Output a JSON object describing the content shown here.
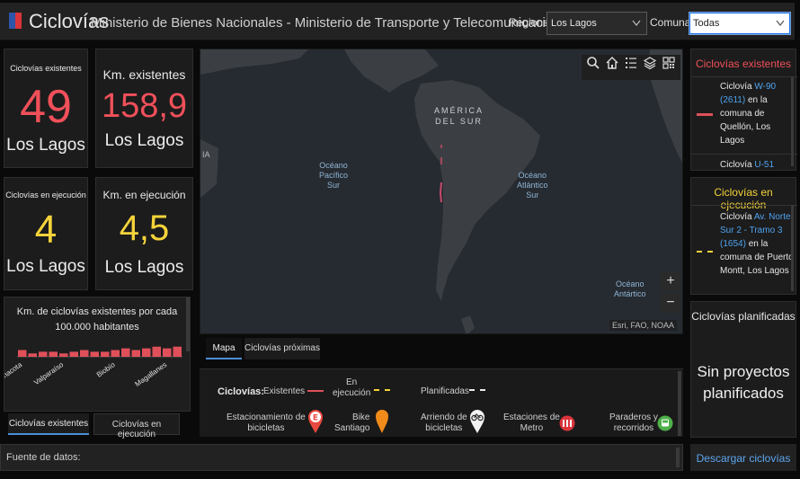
{
  "header": {
    "title": "Ciclovías",
    "subtitle": "Ministerio de Bienes Nacionales - Ministerio de Transporte y Telecomunicaciones",
    "regiones_label": "Regiones",
    "regiones_value": "Los Lagos",
    "comunas_label": "Comunas",
    "comunas_value": "Todas"
  },
  "stats": {
    "existing_count_label": "Ciclovías existentes",
    "existing_count": "49",
    "existing_count_region": "Los Lagos",
    "existing_km_label": "Km. existentes",
    "existing_km": "158,9",
    "existing_km_region": "Los Lagos",
    "exec_count_label": "Ciclovías en ejecución",
    "exec_count": "4",
    "exec_count_region": "Los Lagos",
    "exec_km_label": "Km. en ejecución",
    "exec_km": "4,5",
    "exec_km_region": "Los Lagos"
  },
  "chart_data": {
    "type": "bar",
    "title": "Km. de ciclovías existentes por cada 100.000 habitantes",
    "tick_labels": [
      "Parinacota",
      "Valparaíso",
      "Biobío",
      "Magallanes"
    ],
    "values": [
      4,
      2,
      3,
      3,
      2,
      3,
      4,
      3,
      3,
      4,
      5,
      4,
      5,
      6,
      5,
      6
    ],
    "color": "#e0505a",
    "xlabel": "",
    "ylabel": ""
  },
  "left_tabs": [
    "Ciclovías existentes",
    "Ciclovías en ejecución"
  ],
  "map": {
    "labels": {
      "continent_1": "AMÉRICA",
      "continent_2": "DEL SUR",
      "pacific_1": "Océano",
      "pacific_2": "Pacífico",
      "pacific_3": "Sur",
      "atlantic_1": "Océano",
      "atlantic_2": "Atlántico",
      "atlantic_3": "Sur",
      "antarctic_1": "Océano",
      "antarctic_2": "Antártico",
      "edge": "IA"
    },
    "attribution": "Esri, FAO, NOAA",
    "zoom_in": "+",
    "zoom_out": "−",
    "tools": [
      "search-icon",
      "home-icon",
      "list-icon",
      "layers-icon",
      "qr-icon"
    ]
  },
  "map_tabs": [
    "Mapa",
    "Ciclovías próximas"
  ],
  "legend": {
    "title": "Ciclovías:",
    "existentes": "Existentes",
    "en_ejecucion_1": "En",
    "en_ejecucion_2": "ejecución",
    "planificadas": "Planificadas",
    "estacionamiento_1": "Estacionamiento de",
    "estacionamiento_2": "bicicletas",
    "bike_1": "Bike",
    "bike_2": "Santiago",
    "arriendo_1": "Arriendo de",
    "arriendo_2": "bicicletas",
    "metro_1": "Estaciones de",
    "metro_2": "Metro",
    "paraderos_1": "Paraderos y",
    "paraderos_2": "recorridos",
    "colors": {
      "existentes": "#e0505a",
      "ejecucion": "#f5d33a",
      "planificadas": "#e8e8e8"
    }
  },
  "right": {
    "existentes_title": "Ciclovías existentes",
    "existentes_item": {
      "prefix": "Ciclovía",
      "link": "W-90 (2611)",
      "suffix": "en la comuna de Quellón, Los Lagos"
    },
    "existentes_next": {
      "prefix": "Ciclovía",
      "link": "U-51"
    },
    "ejecucion_title": "Ciclovías en ejecución",
    "ejecucion_item": {
      "prefix": "Ciclovía",
      "link": "Av. Norte Sur 2 - Tramo 3 (1654)",
      "suffix": "en la comuna de Puerto Montt, Los Lagos"
    },
    "planificadas_title": "Ciclovías planificadas",
    "planificadas_empty": "Sin proyectos planificados"
  },
  "footer": {
    "source_label": "Fuente de datos:",
    "download_label": "Descargar ciclovías"
  }
}
